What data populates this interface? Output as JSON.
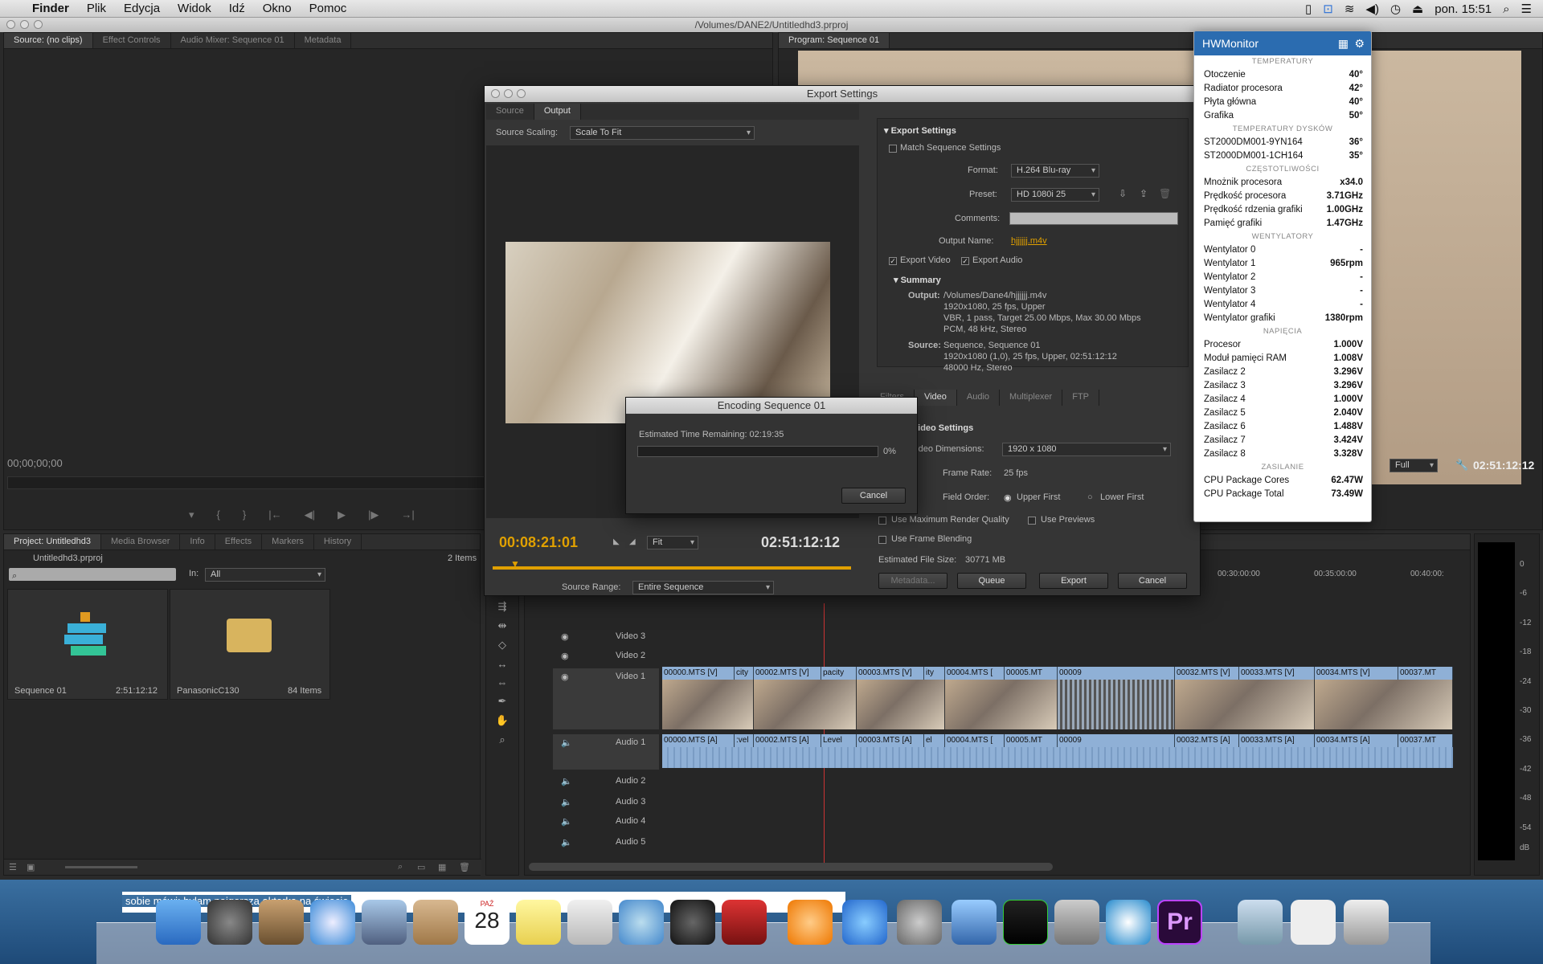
{
  "menubar": {
    "app": "Finder",
    "items": [
      "Plik",
      "Edycja",
      "Widok",
      "Idź",
      "Okno",
      "Pomoc"
    ],
    "clock": "pon. 15:51"
  },
  "window": {
    "title": "/Volumes/DANE2/Untitledhd3.prproj"
  },
  "source_panel": {
    "tabs": [
      "Source: (no clips)",
      "Effect Controls",
      "Audio Mixer: Sequence 01",
      "Metadata"
    ],
    "timecode": "00;00;00;00"
  },
  "program_panel": {
    "tab": "Program: Sequence 01",
    "zoom": "Full",
    "timecode": "02:51:12:12"
  },
  "project_panel": {
    "tabs": [
      "Project: Untitledhd3",
      "Media Browser",
      "Info",
      "Effects",
      "Markers",
      "History"
    ],
    "file": "Untitledhd3.prproj",
    "count": "2 Items",
    "in_label": "In:",
    "in_value": "All",
    "items": [
      {
        "name": "Sequence 01",
        "meta": "2:51:12:12"
      },
      {
        "name": "PanasonicC130",
        "meta": "84 Items"
      }
    ]
  },
  "export": {
    "title": "Export Settings",
    "tabs": [
      "Source",
      "Output"
    ],
    "scaling_label": "Source Scaling:",
    "scaling_value": "Scale To Fit",
    "timecode_left": "00:08:21:01",
    "fit": "Fit",
    "timecode_right": "02:51:12:12",
    "range_label": "Source Range:",
    "range_value": "Entire Sequence",
    "section": "Export Settings",
    "match_label": "Match Sequence Settings",
    "format_label": "Format:",
    "format_value": "H.264 Blu-ray",
    "preset_label": "Preset:",
    "preset_value": "HD 1080i 25",
    "comments_label": "Comments:",
    "output_label": "Output Name:",
    "output_value": "hjjjjjj.m4v",
    "export_video": "Export Video",
    "export_audio": "Export Audio",
    "summary": "Summary",
    "summary_output_label": "Output:",
    "summary_output": [
      "/Volumes/Dane4/hjjjjjj.m4v",
      "1920x1080, 25 fps, Upper",
      "VBR, 1 pass, Target 25.00 Mbps, Max 30.00 Mbps",
      "PCM, 48 kHz, Stereo"
    ],
    "summary_source_label": "Source:",
    "summary_source": [
      "Sequence, Sequence 01",
      "1920x1080 (1,0), 25 fps, Upper, 02:51:12:12",
      "48000 Hz, Stereo"
    ],
    "subtabs": [
      "Filters",
      "Video",
      "Audio",
      "Multiplexer",
      "FTP"
    ],
    "video_settings": "Video Settings",
    "dims_label": "Video Dimensions:",
    "dims_value": "1920 x 1080",
    "framerate_label": "Frame Rate:",
    "framerate_value": "25 fps",
    "field_label": "Field Order:",
    "field_upper": "Upper First",
    "field_lower": "Lower First",
    "max_quality": "Use Maximum Render Quality",
    "previews": "Use Previews",
    "blending": "Use Frame Blending",
    "filesize_label": "Estimated File Size:",
    "filesize_value": "30771 MB",
    "buttons": {
      "metadata": "Metadata...",
      "queue": "Queue",
      "export": "Export",
      "cancel": "Cancel"
    }
  },
  "encoding": {
    "title": "Encoding Sequence 01",
    "remaining": "Estimated Time Remaining: 02:19:35",
    "percent": "0%",
    "progress": 0,
    "cancel": "Cancel"
  },
  "timeline": {
    "ruler": [
      "00:30:00:00",
      "00:35:00:00",
      "00:40:00:"
    ],
    "tracks": [
      "Video 3",
      "Video 2",
      "Video 1",
      "Audio 1",
      "Audio 2",
      "Audio 3",
      "Audio 4",
      "Audio 5"
    ],
    "video_clips": [
      "00000.MTS [V]",
      "city",
      "00002.MTS [V]",
      "pacity",
      "00003.MTS [V]",
      "ity",
      "00004.MTS [",
      "00005.MT",
      "00009",
      "00032.MTS [V]",
      "00033.MTS [V]",
      "00034.MTS [V]",
      "00037.MT"
    ],
    "audio_clips": [
      "00000.MTS [A]",
      ":vel",
      "00002.MTS [A]",
      "Level",
      "00003.MTS [A]",
      "el",
      "00004.MTS [",
      "00005.MT",
      "00009",
      "00032.MTS [A]",
      "00033.MTS [A]",
      "00034.MTS [A]",
      "00037.MT"
    ]
  },
  "meter": {
    "labels": [
      "0",
      "-6",
      "-12",
      "-18",
      "-24",
      "-30",
      "-36",
      "-42",
      "-48",
      "-54",
      "dB"
    ]
  },
  "hwmonitor": {
    "title": "HWMonitor",
    "sections": [
      {
        "name": "TEMPERATURY",
        "rows": [
          [
            "Otoczenie",
            "40°"
          ],
          [
            "Radiator procesora",
            "42°"
          ],
          [
            "Płyta główna",
            "40°"
          ],
          [
            "Grafika",
            "50°"
          ]
        ]
      },
      {
        "name": "TEMPERATURY DYSKÓW",
        "rows": [
          [
            "ST2000DM001-9YN164",
            "36°"
          ],
          [
            "ST2000DM001-1CH164",
            "35°"
          ]
        ]
      },
      {
        "name": "CZĘSTOTLIWOŚCI",
        "rows": [
          [
            "Mnożnik procesora",
            "x34.0"
          ],
          [
            "Prędkość procesora",
            "3.71GHz"
          ],
          [
            "Prędkość rdzenia grafiki",
            "1.00GHz"
          ],
          [
            "Pamięć grafiki",
            "1.47GHz"
          ]
        ]
      },
      {
        "name": "WENTYLATORY",
        "rows": [
          [
            "Wentylator 0",
            "-"
          ],
          [
            "Wentylator 1",
            "965rpm"
          ],
          [
            "Wentylator 2",
            "-"
          ],
          [
            "Wentylator 3",
            "-"
          ],
          [
            "Wentylator 4",
            "-"
          ],
          [
            "Wentylator grafiki",
            "1380rpm"
          ]
        ]
      },
      {
        "name": "NAPIĘCIA",
        "rows": [
          [
            "Procesor",
            "1.000V"
          ],
          [
            "Moduł pamięci RAM",
            "1.008V"
          ],
          [
            "Zasilacz 2",
            "3.296V"
          ],
          [
            "Zasilacz 3",
            "3.296V"
          ],
          [
            "Zasilacz 4",
            "1.000V"
          ],
          [
            "Zasilacz 5",
            "2.040V"
          ],
          [
            "Zasilacz 6",
            "1.488V"
          ],
          [
            "Zasilacz 7",
            "3.424V"
          ],
          [
            "Zasilacz 8",
            "3.328V"
          ]
        ]
      },
      {
        "name": "ZASILANIE",
        "rows": [
          [
            "CPU Package Cores",
            "62.47W"
          ],
          [
            "CPU Package Total",
            "73.49W"
          ]
        ]
      }
    ]
  },
  "desktop": {
    "caption": "sobie mówi: byłam najgorsza aktorka na świecie",
    "calendar_month": "PAŹ",
    "calendar_day": "28"
  },
  "colors": {
    "accent": "#e0a000",
    "clip": "#8fb0d6",
    "hw_header": "#2b6cb0"
  }
}
